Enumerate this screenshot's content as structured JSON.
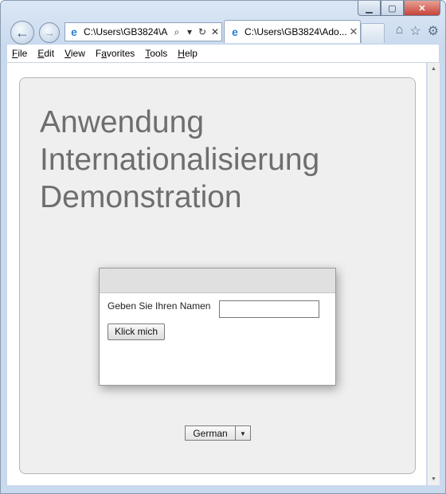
{
  "browser": {
    "address": "C:\\Users\\GB3824\\A",
    "tab_title": "C:\\Users\\GB3824\\Ado...",
    "menu": [
      "File",
      "Edit",
      "View",
      "Favorites",
      "Tools",
      "Help"
    ],
    "menu_mnemonics": [
      "F",
      "E",
      "V",
      "a",
      "T",
      "H"
    ]
  },
  "page": {
    "title_lines": [
      "Anwendung",
      "Internationalisierung",
      "Demonstration"
    ],
    "form": {
      "label": "Geben Sie Ihren Namen",
      "input_value": "",
      "button_label": "Klick mich"
    },
    "language_select": {
      "selected": "German"
    }
  },
  "colors": {
    "panel_bg": "#efefef",
    "title_text": "#6e6e6e",
    "dialog_header": "#e0e0e0"
  },
  "icons": {
    "back": "arrow-left-icon",
    "forward": "arrow-right-icon",
    "home": "home-icon",
    "favorites": "star-icon",
    "tools": "gear-icon"
  }
}
